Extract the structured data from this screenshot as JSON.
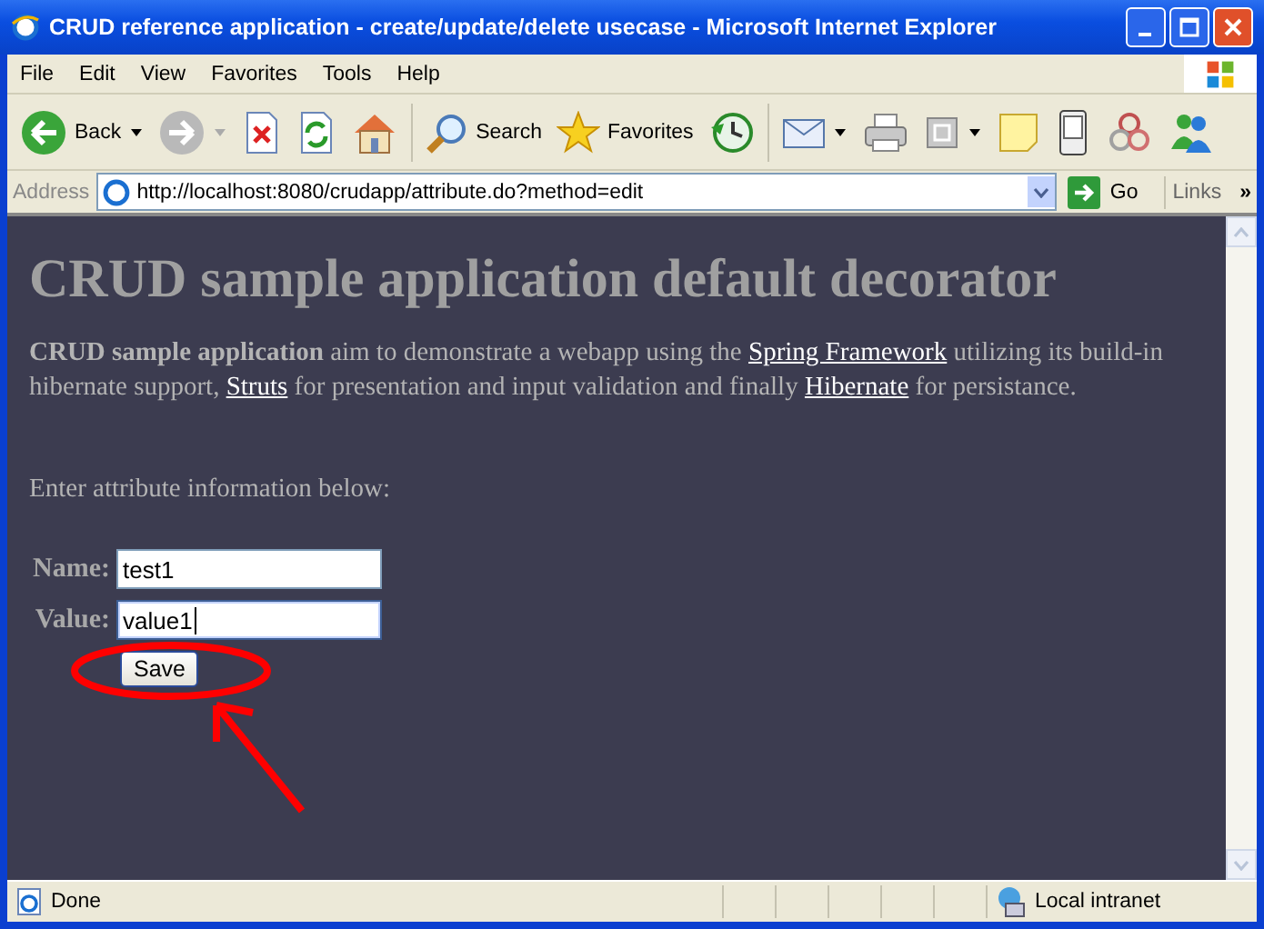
{
  "window": {
    "title": "CRUD reference application - create/update/delete usecase - Microsoft Internet Explorer"
  },
  "menu": [
    "File",
    "Edit",
    "View",
    "Favorites",
    "Tools",
    "Help"
  ],
  "toolbar": [
    {
      "kind": "back",
      "label": "Back"
    },
    {
      "kind": "forward"
    },
    {
      "kind": "stop"
    },
    {
      "kind": "refresh"
    },
    {
      "kind": "home"
    },
    {
      "kind": "search",
      "label": "Search"
    },
    {
      "kind": "favorites",
      "label": "Favorites"
    },
    {
      "kind": "history"
    },
    {
      "kind": "mail"
    },
    {
      "kind": "print"
    },
    {
      "kind": "edit"
    },
    {
      "kind": "note"
    },
    {
      "kind": "phone"
    },
    {
      "kind": "research"
    },
    {
      "kind": "messenger"
    }
  ],
  "address_bar": {
    "label": "Address",
    "url": "http://localhost:8080/crudapp/attribute.do?method=edit",
    "go": "Go",
    "links": "Links",
    "overflow": "»"
  },
  "page": {
    "heading": "CRUD sample application default decorator",
    "intro": [
      {
        "kind": "text",
        "text": "**CRUD sample application** aim to demonstrate a webapp using the "
      },
      {
        "kind": "link",
        "text": "Spring Framework"
      },
      {
        "kind": "text",
        "text": " utilizing its build-in hibernate support, "
      },
      {
        "kind": "link",
        "text": "Struts"
      },
      {
        "kind": "text",
        "text": " for presentation and input validation and finally "
      },
      {
        "kind": "link",
        "text": "Hibernate"
      },
      {
        "kind": "text",
        "text": " for persistance."
      }
    ],
    "prompt": "Enter attribute information below:",
    "fields": [
      {
        "label": "Name:",
        "value": "test1",
        "focused": false
      },
      {
        "label": "Value:",
        "value": "value1",
        "focused": true
      }
    ],
    "save_button": "Save"
  },
  "status_bar": {
    "text": "Done",
    "zone": "Local intranet"
  }
}
